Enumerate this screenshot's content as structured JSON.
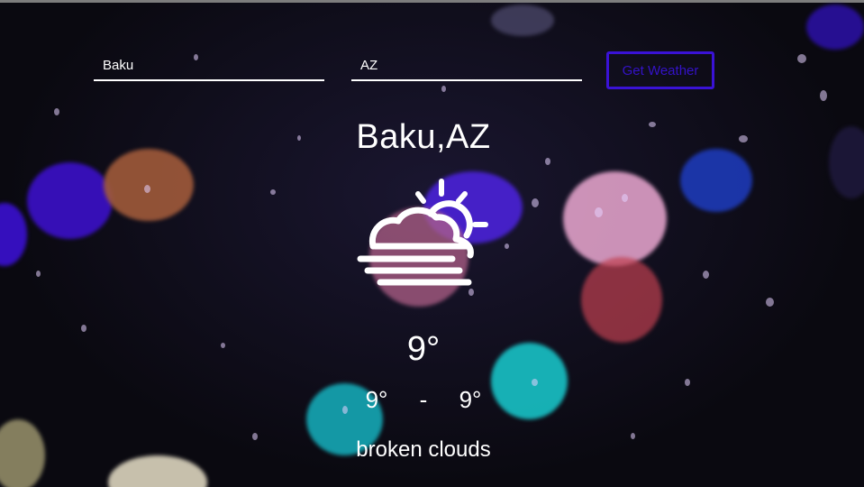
{
  "search": {
    "city_value": "Baku",
    "country_value": "AZ",
    "button_label": "Get Weather"
  },
  "weather": {
    "location": "Baku,AZ",
    "icon": "partly-cloudy-fog-icon",
    "temp": "9°",
    "min": "9°",
    "separator": "-",
    "max": "9°",
    "description": "broken clouds"
  },
  "colors": {
    "button_border": "#3a12d6",
    "button_text": "#3412c8"
  }
}
